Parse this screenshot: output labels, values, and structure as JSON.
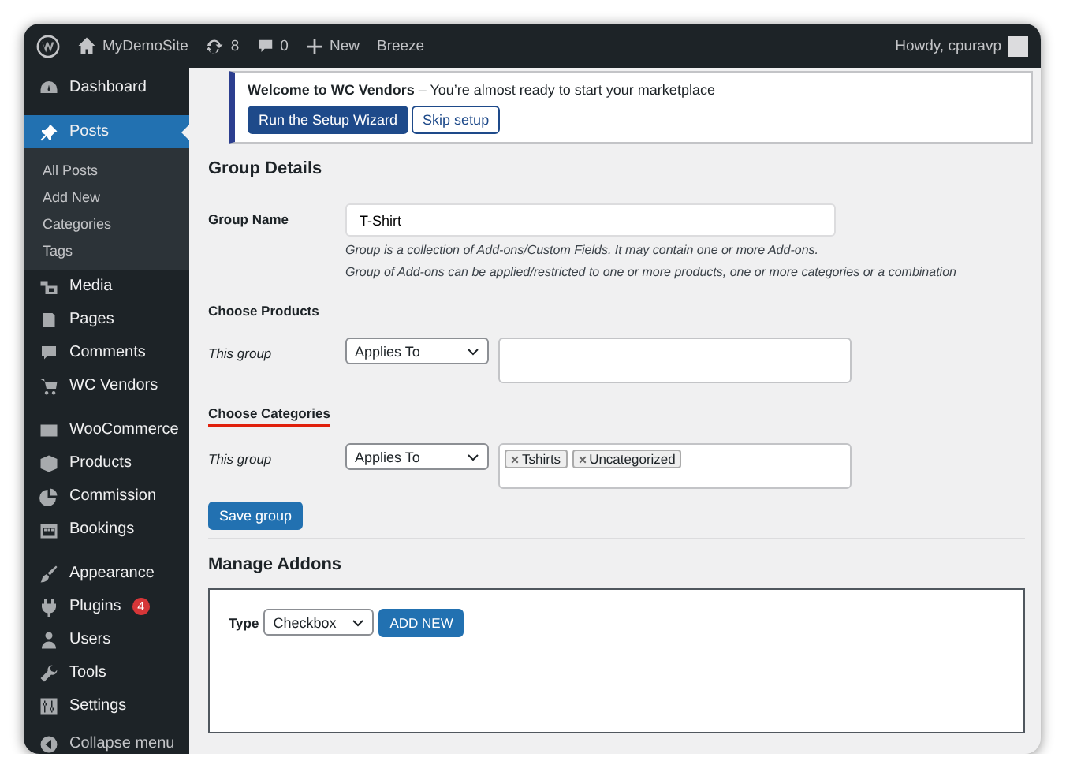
{
  "admin_bar": {
    "site_name": "MyDemoSite",
    "updates": "8",
    "comments": "0",
    "new": "New",
    "breeze": "Breeze",
    "greeting": "Howdy, cpuravp"
  },
  "sidebar": {
    "groups": [
      [
        {
          "label": "Dashboard",
          "selected": false
        }
      ],
      [
        {
          "label": "Posts",
          "selected": true,
          "children": [
            {
              "label": "All Posts",
              "selected": false
            },
            {
              "label": "Add New",
              "selected": false
            },
            {
              "label": "Categories",
              "selected": false
            },
            {
              "label": "Tags",
              "selected": false
            }
          ]
        },
        {
          "label": "Media",
          "selected": false
        },
        {
          "label": "Pages",
          "selected": false
        },
        {
          "label": "Comments",
          "selected": false
        },
        {
          "label": "WC Vendors",
          "selected": false
        }
      ],
      [
        {
          "label": "WooCommerce",
          "selected": false
        },
        {
          "label": "Products",
          "selected": false
        },
        {
          "label": "Commission",
          "selected": false
        },
        {
          "label": "Bookings",
          "selected": false
        }
      ],
      [
        {
          "label": "Appearance",
          "selected": false
        },
        {
          "label": "Plugins",
          "selected": false,
          "badge": "4"
        },
        {
          "label": "Users",
          "selected": false
        },
        {
          "label": "Tools",
          "selected": false
        },
        {
          "label": "Settings",
          "selected": false
        }
      ]
    ],
    "collapse": "Collapse menu"
  },
  "notice": {
    "text": "**Welcome to WC Vendors** – You’re almost ready to start your marketplace",
    "buttons": [
      {
        "label": "Run the Setup Wizard",
        "kind": "primary"
      },
      {
        "label": "Skip setup",
        "kind": "secondary"
      }
    ]
  },
  "group_details": {
    "heading": "Group Details",
    "group_name": {
      "label": "Group Name",
      "value": "T-Shirt",
      "help": [
        "Group is a collection of Add-ons/Custom Fields. It may contain one or more Add-ons.",
        "Group of Add-ons can be applied/restricted to one or more products, one or more categories or a combination"
      ]
    },
    "sections": [
      {
        "heading": "Choose Products",
        "highlighted": false,
        "row_label": "This group",
        "select": "Applies To"
      },
      {
        "heading": "Choose Categories",
        "highlighted": true,
        "row_label": "This group",
        "select": "Applies To",
        "tags": [
          "Tshirts",
          "Uncategorized"
        ]
      }
    ],
    "save": "Save group"
  },
  "manage_addons": {
    "heading": "Manage Addons",
    "type_label": "Type",
    "type_value": "Checkbox",
    "add_button": "ADD NEW"
  }
}
